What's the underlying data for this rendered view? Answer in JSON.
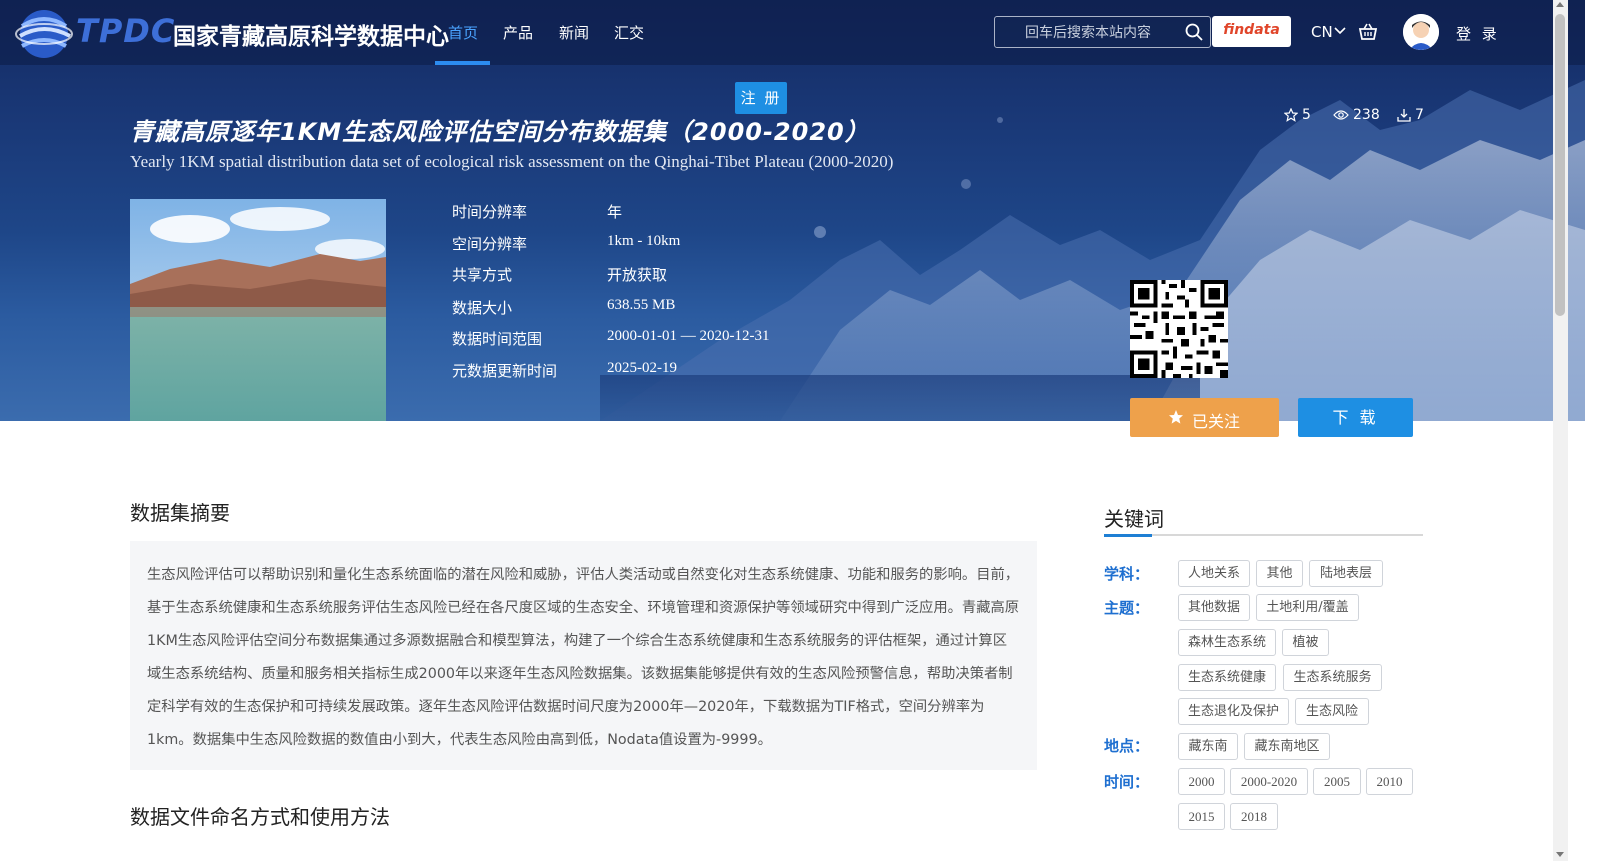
{
  "header": {
    "logo_text": "TPDC",
    "site_name": "国家青藏高原科学数据中心",
    "nav": [
      {
        "label": "首页",
        "active": true
      },
      {
        "label": "产品",
        "active": false
      },
      {
        "label": "新闻",
        "active": false
      },
      {
        "label": "汇交",
        "active": false
      }
    ],
    "search_placeholder": "回车后搜索本站内容",
    "findata_label": "findata",
    "lang": "CN",
    "login_label": "登 录",
    "register_label": "注 册"
  },
  "dataset": {
    "title_cn": "青藏高原逐年1KM生态风险评估空间分布数据集（2000-2020）",
    "title_en": "Yearly 1KM spatial distribution data set of ecological risk assessment on the Qinghai-Tibet Plateau (2000-2020)",
    "stats": {
      "stars": "5",
      "views": "238",
      "downloads": "7"
    },
    "meta": [
      {
        "label": "时间分辨率",
        "value": "年"
      },
      {
        "label": "空间分辨率",
        "value": "1km - 10km"
      },
      {
        "label": "共享方式",
        "value": "开放获取"
      },
      {
        "label": "数据大小",
        "value": "638.55 MB"
      },
      {
        "label": "数据时间范围",
        "value": "2000-01-01 — 2020-12-31"
      },
      {
        "label": "元数据更新时间",
        "value": "2025-02-19"
      }
    ],
    "follow_label": "已关注",
    "download_label": "下 载"
  },
  "abstract": {
    "title": "数据集摘要",
    "text": "生态风险评估可以帮助识别和量化生态系统面临的潜在风险和威胁，评估人类活动或自然变化对生态系统健康、功能和服务的影响。目前，基于生态系统健康和生态系统服务评估生态风险已经在各尺度区域的生态安全、环境管理和资源保护等领域研究中得到广泛应用。青藏高原1KM生态风险评估空间分布数据集通过多源数据融合和模型算法，构建了一个综合生态系统健康和生态系统服务的评估框架，通过计算区域生态系统结构、质量和服务相关指标生成2000年以来逐年生态风险数据集。该数据集能够提供有效的生态风险预警信息，帮助决策者制定科学有效的生态保护和可持续发展政策。逐年生态风险评估数据时间尺度为2000年—2020年，下载数据为TIF格式，空间分辨率为1km。数据集中生态风险数据的数值由小到大，代表生态风险由高到低，Nodata值设置为-9999。"
  },
  "file_naming": {
    "title": "数据文件命名方式和使用方法"
  },
  "keywords": {
    "title": "关键词",
    "subject_label": "学科：",
    "subject": [
      "人地关系",
      "其他",
      "陆地表层"
    ],
    "theme_label": "主题：",
    "theme": [
      "其他数据",
      "土地利用/覆盖",
      "森林生态系统",
      "植被",
      "生态系统健康",
      "生态系统服务",
      "生态退化及保护",
      "生态风险"
    ],
    "place_label": "地点：",
    "place": [
      "藏东南",
      "藏东南地区"
    ],
    "time_label": "时间：",
    "time": [
      "2000",
      "2000-2020",
      "2005",
      "2010",
      "2015",
      "2018"
    ]
  },
  "colors": {
    "accent": "#1e8fe3",
    "follow": "#eea14b",
    "keyword_label": "#1e6fd0"
  }
}
